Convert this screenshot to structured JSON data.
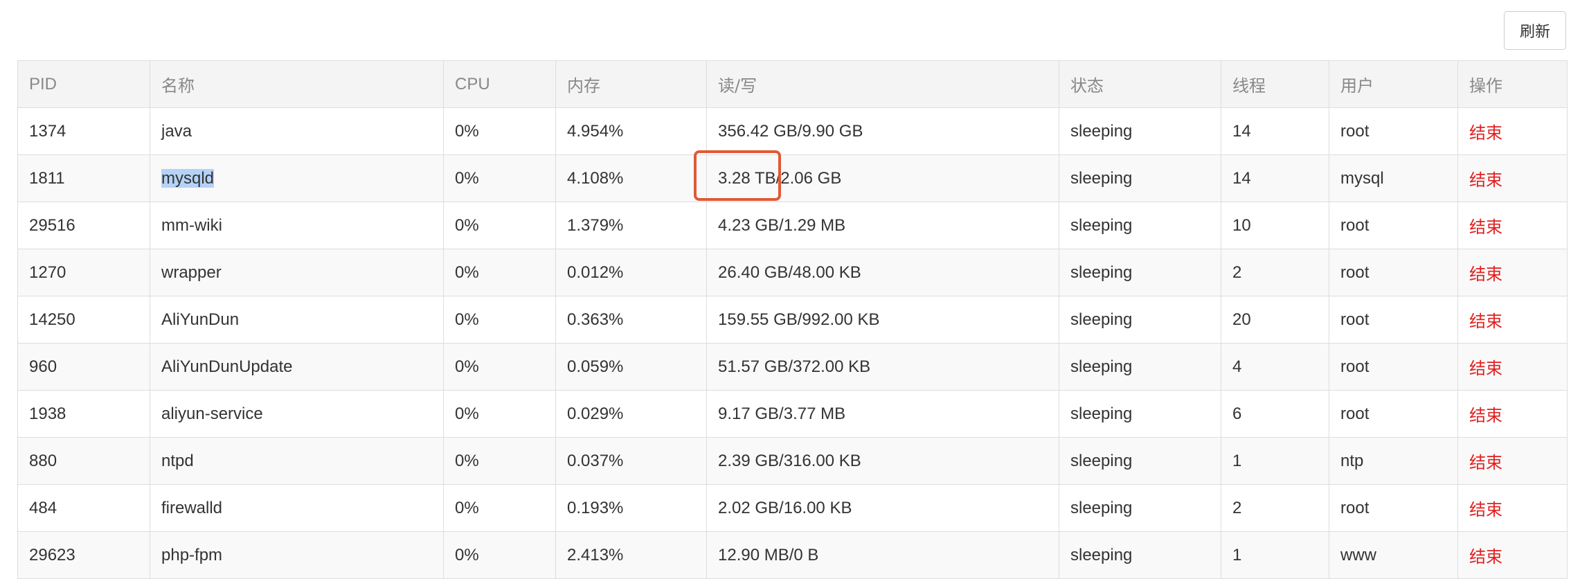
{
  "toolbar": {
    "refresh_label": "刷新"
  },
  "table": {
    "columns": [
      {
        "label": "PID"
      },
      {
        "label": "名称"
      },
      {
        "label": "CPU"
      },
      {
        "label": "内存"
      },
      {
        "label": "读/写"
      },
      {
        "label": "状态"
      },
      {
        "label": "线程"
      },
      {
        "label": "用户"
      },
      {
        "label": "操作"
      }
    ],
    "rows": [
      {
        "pid": "1374",
        "name": "java",
        "cpu": "0%",
        "memory": "4.954%",
        "io": "356.42 GB/9.90 GB",
        "status": "sleeping",
        "threads": "14",
        "user": "root",
        "action": "结束"
      },
      {
        "pid": "1811",
        "name": "mysqld",
        "cpu": "0%",
        "memory": "4.108%",
        "io": "3.28 TB/2.06 GB",
        "status": "sleeping",
        "threads": "14",
        "user": "mysql",
        "action": "结束"
      },
      {
        "pid": "29516",
        "name": "mm-wiki",
        "cpu": "0%",
        "memory": "1.379%",
        "io": "4.23 GB/1.29 MB",
        "status": "sleeping",
        "threads": "10",
        "user": "root",
        "action": "结束"
      },
      {
        "pid": "1270",
        "name": "wrapper",
        "cpu": "0%",
        "memory": "0.012%",
        "io": "26.40 GB/48.00 KB",
        "status": "sleeping",
        "threads": "2",
        "user": "root",
        "action": "结束"
      },
      {
        "pid": "14250",
        "name": "AliYunDun",
        "cpu": "0%",
        "memory": "0.363%",
        "io": "159.55 GB/992.00 KB",
        "status": "sleeping",
        "threads": "20",
        "user": "root",
        "action": "结束"
      },
      {
        "pid": "960",
        "name": "AliYunDunUpdate",
        "cpu": "0%",
        "memory": "0.059%",
        "io": "51.57 GB/372.00 KB",
        "status": "sleeping",
        "threads": "4",
        "user": "root",
        "action": "结束"
      },
      {
        "pid": "1938",
        "name": "aliyun-service",
        "cpu": "0%",
        "memory": "0.029%",
        "io": "9.17 GB/3.77 MB",
        "status": "sleeping",
        "threads": "6",
        "user": "root",
        "action": "结束"
      },
      {
        "pid": "880",
        "name": "ntpd",
        "cpu": "0%",
        "memory": "0.037%",
        "io": "2.39 GB/316.00 KB",
        "status": "sleeping",
        "threads": "1",
        "user": "ntp",
        "action": "结束"
      },
      {
        "pid": "484",
        "name": "firewalld",
        "cpu": "0%",
        "memory": "0.193%",
        "io": "2.02 GB/16.00 KB",
        "status": "sleeping",
        "threads": "2",
        "user": "root",
        "action": "结束"
      },
      {
        "pid": "29623",
        "name": "php-fpm",
        "cpu": "0%",
        "memory": "2.413%",
        "io": "12.90 MB/0 B",
        "status": "sleeping",
        "threads": "1",
        "user": "www",
        "action": "结束"
      }
    ]
  },
  "colors": {
    "kill_action": "#e02020",
    "header_bg": "#f4f4f4",
    "annotation_box": "#e05a35",
    "text_selection": "#b4d3f7"
  }
}
